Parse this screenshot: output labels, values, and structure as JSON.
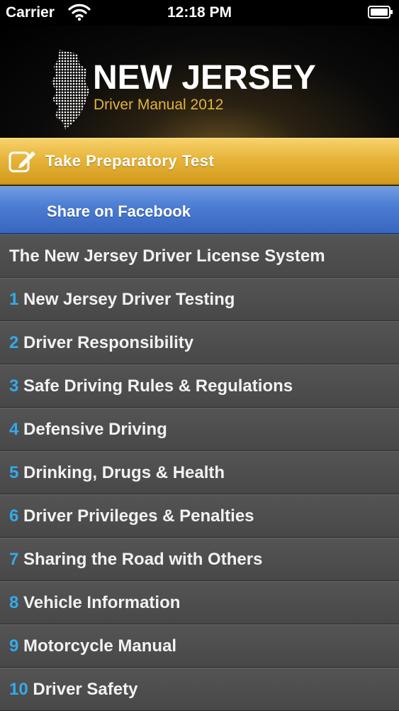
{
  "status_bar": {
    "carrier": "Carrier",
    "time": "12:18 PM",
    "wifi_icon": "wifi-icon",
    "battery_icon": "battery-icon"
  },
  "header": {
    "title": "NEW JERSEY",
    "subtitle": "Driver Manual 2012",
    "logo_icon": "new-jersey-map-icon",
    "subtitle_color": "#e2b43b"
  },
  "actions": {
    "test_label": "Take Preparatory Test",
    "test_icon": "edit-icon",
    "test_color": "#e7b43a",
    "facebook_label": "Share on Facebook",
    "facebook_color": "#4a7bd1"
  },
  "menu": {
    "number_color": "#35a9ea",
    "items": [
      {
        "num": "",
        "label": "The New Jersey Driver License System"
      },
      {
        "num": "1",
        "label": "New Jersey Driver Testing"
      },
      {
        "num": "2",
        "label": "Driver Responsibility"
      },
      {
        "num": "3",
        "label": "Safe Driving Rules & Regulations"
      },
      {
        "num": "4",
        "label": "Defensive Driving"
      },
      {
        "num": "5",
        "label": "Drinking, Drugs & Health"
      },
      {
        "num": "6",
        "label": "Driver Privileges & Penalties"
      },
      {
        "num": "7",
        "label": "Sharing the Road with Others"
      },
      {
        "num": "8",
        "label": "Vehicle Information"
      },
      {
        "num": "9",
        "label": "Motorcycle Manual"
      },
      {
        "num": "10",
        "label": "Driver Safety"
      }
    ]
  }
}
